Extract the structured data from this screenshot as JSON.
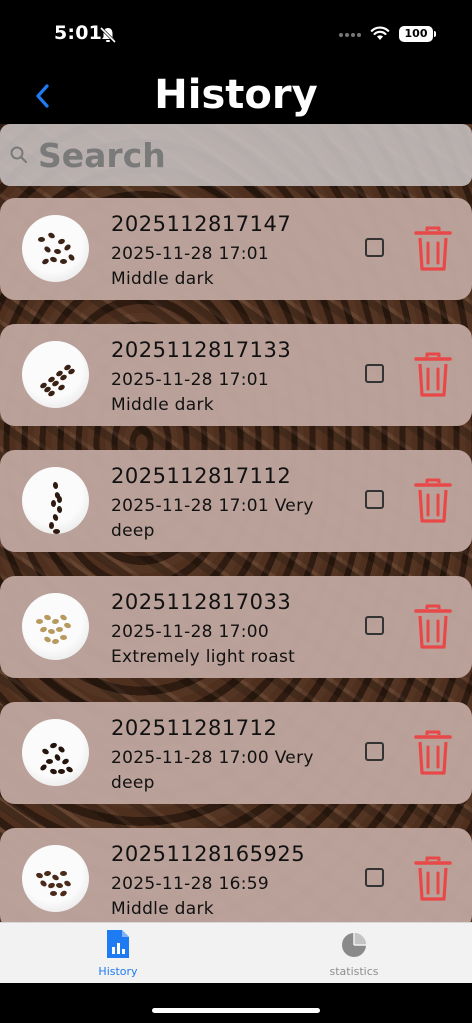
{
  "status_bar": {
    "time": "5:01",
    "battery": "100"
  },
  "nav": {
    "title": "History"
  },
  "search": {
    "placeholder": "Search",
    "value": ""
  },
  "records": [
    {
      "id": "2025112817147",
      "meta": "2025-11-28 17:01\nMiddle dark"
    },
    {
      "id": "2025112817133",
      "meta": "2025-11-28 17:01\nMiddle dark"
    },
    {
      "id": "2025112817112",
      "meta": "2025-11-28 17:01  Very deep"
    },
    {
      "id": "2025112817033",
      "meta": "2025-11-28 17:00\nExtremely light roast"
    },
    {
      "id": "202511281712",
      "meta": "2025-11-28 17:00  Very deep"
    },
    {
      "id": "20251128165925",
      "meta": "2025-11-28 16:59\nMiddle dark"
    }
  ],
  "tabs": [
    {
      "label": "History",
      "icon": "document-chart-icon",
      "active": true
    },
    {
      "label": "statistics",
      "icon": "pie-chart-icon",
      "active": false
    }
  ],
  "colors": {
    "accent": "#1E7BF2",
    "delete": "#E84848",
    "card": "#BEA59E"
  }
}
